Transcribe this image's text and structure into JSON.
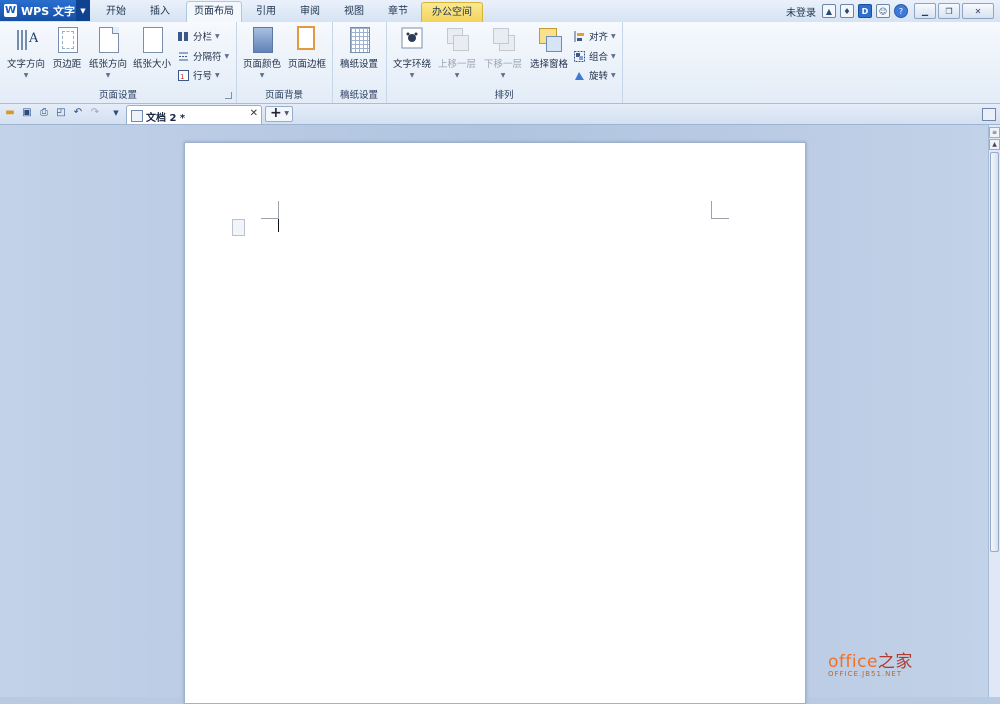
{
  "app": {
    "name": "WPS 文字",
    "logo": "W"
  },
  "menu_tabs": [
    {
      "label": "开始"
    },
    {
      "label": "插入"
    },
    {
      "label": "页面布局"
    },
    {
      "label": "引用"
    },
    {
      "label": "审阅"
    },
    {
      "label": "视图"
    },
    {
      "label": "章节"
    },
    {
      "label": "办公空间"
    }
  ],
  "account": {
    "login_label": "未登录"
  },
  "ribbon": {
    "page_setup": {
      "label": "页面设置",
      "text_direction": "文字方向",
      "margins": "页边距",
      "orientation": "纸张方向",
      "paper_size": "纸张大小",
      "columns": "分栏",
      "breaks": "分隔符",
      "line_numbers": "行号"
    },
    "page_background": {
      "label": "页面背景",
      "page_color": "页面颜色",
      "page_border": "页面边框"
    },
    "manuscript": {
      "label": "稿纸设置",
      "manuscript_settings": "稿纸设置"
    },
    "arrange": {
      "label": "排列",
      "text_wrap": "文字环绕",
      "bring_forward": "上移一层",
      "send_backward": "下移一层",
      "selection_pane": "选择窗格",
      "align": "对齐",
      "group": "组合",
      "rotate": "旋转"
    }
  },
  "document_tab": {
    "title": "文档 2 *"
  },
  "watermark": {
    "main": "office",
    "main_cn": "之家",
    "sub": "OFFICE.JB51.NET"
  }
}
